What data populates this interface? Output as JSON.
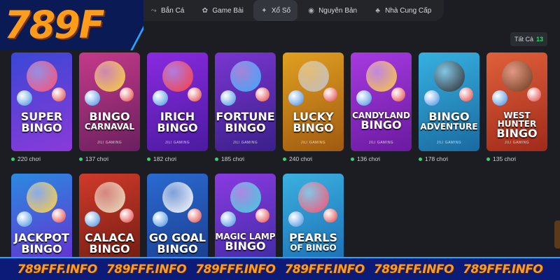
{
  "logo": {
    "text": "789F"
  },
  "nav": {
    "items": [
      {
        "label": "Bắn Cá",
        "icon": "fish-icon",
        "glyph": "⤳",
        "active": false
      },
      {
        "label": "Game Bài",
        "icon": "cards-icon",
        "glyph": "✿",
        "active": false
      },
      {
        "label": "Xổ Số",
        "icon": "lottery-icon",
        "glyph": "✦",
        "active": true
      },
      {
        "label": "Nguyên Bản",
        "icon": "gamepad-icon",
        "glyph": "◉",
        "active": false
      },
      {
        "label": "Nhà Cung Cấp",
        "icon": "provider-icon",
        "glyph": "♣",
        "active": false
      }
    ]
  },
  "filter": {
    "label": "Tất Cả",
    "count": "13"
  },
  "games": [
    {
      "line1": "SUPER",
      "line2": "BINGO",
      "brand": "",
      "players": "220 chơi",
      "bg": [
        "#3a47d6",
        "#8a3ad8"
      ],
      "accent": "#ff4d6d"
    },
    {
      "line1": "BINGO",
      "line2": "CARNAVAL",
      "brand": "JILI GAMING",
      "players": "137 chơi",
      "bg": [
        "#c43a8a",
        "#6a1f5e"
      ],
      "accent": "#ffd23a"
    },
    {
      "line1": "IRICH",
      "line2": "BINGO",
      "brand": "JILI GAMING",
      "players": "182 chơi",
      "bg": [
        "#8a2ae0",
        "#4b1aa0"
      ],
      "accent": "#ff3a3a"
    },
    {
      "line1": "FORTUNE",
      "line2": "BINGO",
      "brand": "JILI GAMING",
      "players": "185 chơi",
      "bg": [
        "#7a36d0",
        "#3a1f8a"
      ],
      "accent": "#3aa8ff"
    },
    {
      "line1": "LUCKY",
      "line2": "BINGO",
      "brand": "JILI GAMING",
      "players": "240 chơi",
      "bg": [
        "#e0a020",
        "#a05a10"
      ],
      "accent": "#c0c0c0"
    },
    {
      "line1": "CANDYLAND",
      "line2": "BINGO",
      "brand": "JILI GAMING",
      "players": "136 chơi",
      "bg": [
        "#a63ae0",
        "#6a1aa0"
      ],
      "accent": "#ffc83a"
    },
    {
      "line1": "BINGO",
      "line2": "ADVENTURE",
      "brand": "JILI GAMING",
      "players": "178 chơi",
      "bg": [
        "#36b0e0",
        "#1a6aa0"
      ],
      "accent": "#2a2a2a"
    },
    {
      "line1": "WEST HUNTER",
      "line2": "BINGO",
      "brand": "JILI GAMING",
      "players": "135 chơi",
      "bg": [
        "#e0603a",
        "#a02a1a"
      ],
      "accent": "#6a3a1a"
    },
    {
      "line1": "JACKPOT",
      "line2": "BINGO",
      "brand": "",
      "players": "",
      "bg": [
        "#2a8ae0",
        "#6a2ad0"
      ],
      "accent": "#ffd23a"
    },
    {
      "line1": "CALACA",
      "line2": "BINGO",
      "brand": "",
      "players": "",
      "bg": [
        "#d03a2a",
        "#6a1a10"
      ],
      "accent": "#f0e0c0"
    },
    {
      "line1": "GO GOAL",
      "line2": "BINGO",
      "brand": "",
      "players": "",
      "bg": [
        "#2a6ad0",
        "#1a3a8a"
      ],
      "accent": "#ffffff"
    },
    {
      "line1": "MAGIC LAMP",
      "line2": "BINGO",
      "brand": "",
      "players": "",
      "bg": [
        "#8a3ae0",
        "#3a2aa0"
      ],
      "accent": "#3ad0e0"
    },
    {
      "line1": "PEARLS",
      "line2": "OF BINGO",
      "brand": "",
      "players": "",
      "bg": [
        "#3ab0e0",
        "#1a6ab0"
      ],
      "accent": "#ff4d6d"
    }
  ],
  "footer": {
    "text": "789FFF.INFO"
  }
}
